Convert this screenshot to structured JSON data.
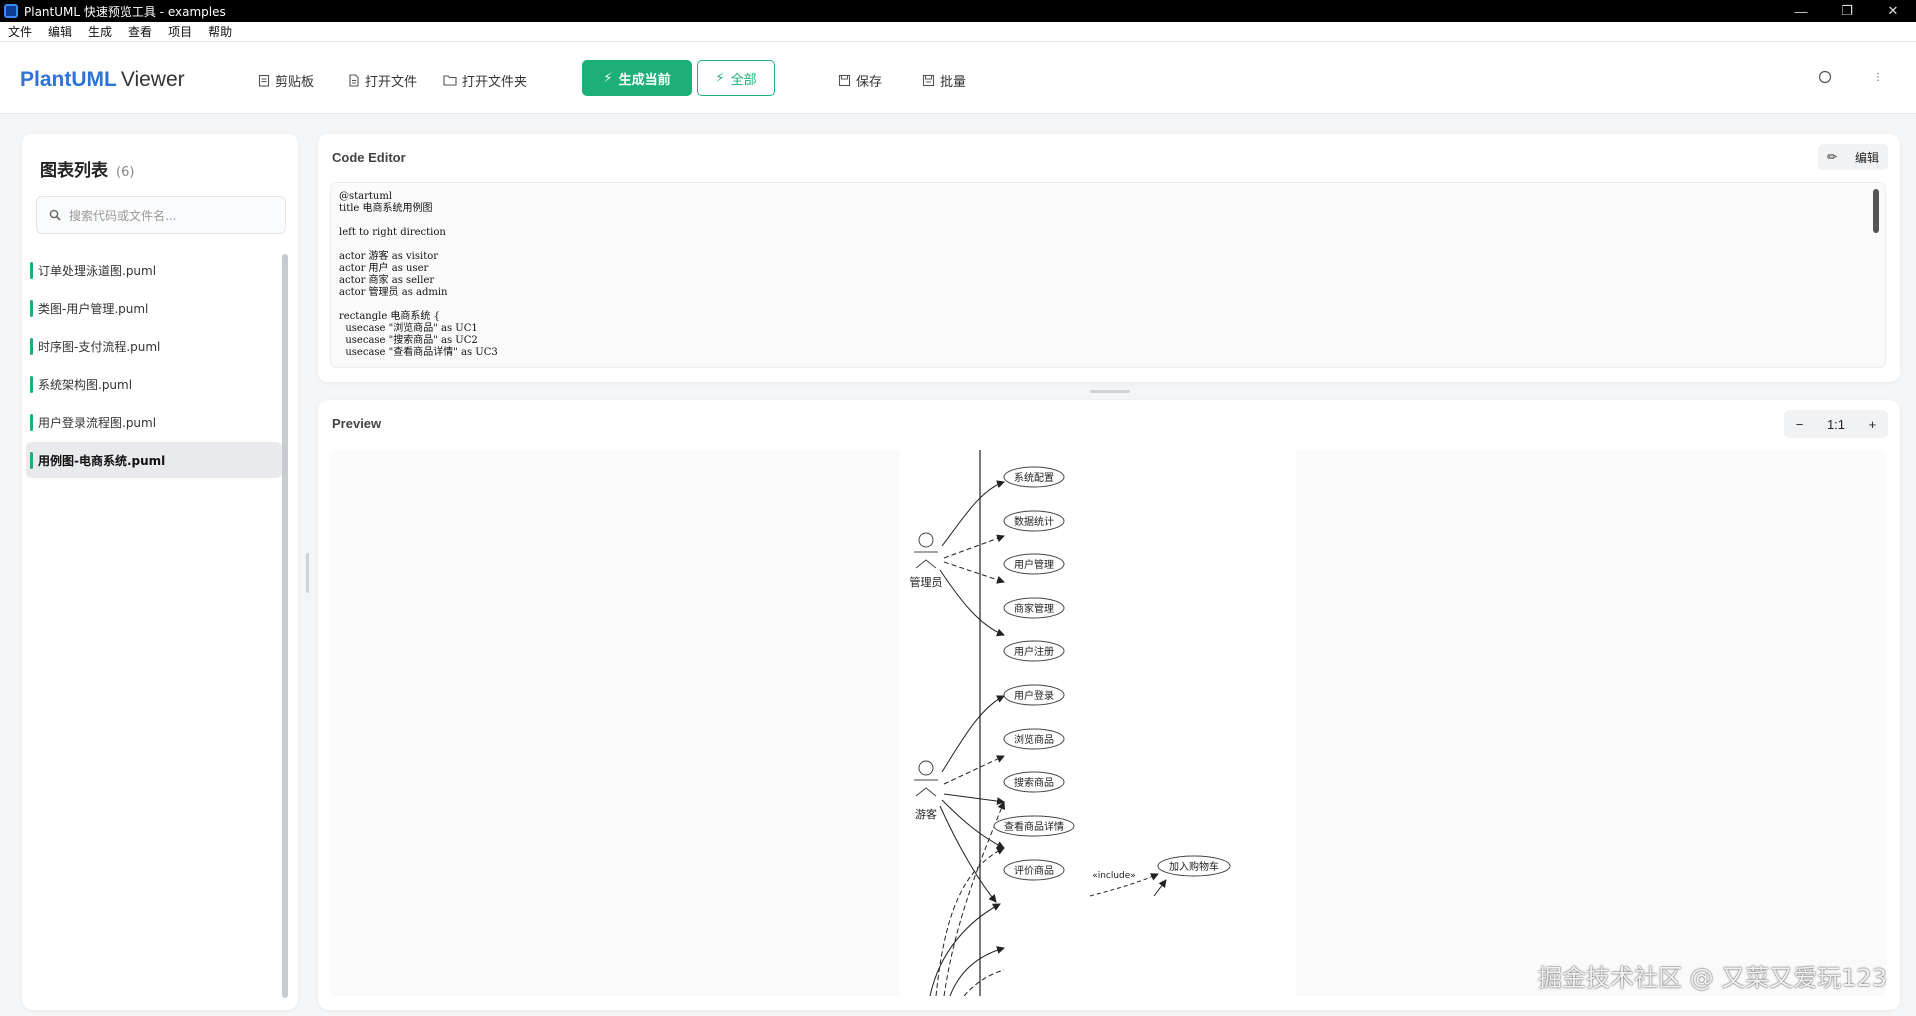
{
  "window": {
    "title": "PlantUML 快速预览工具 - examples",
    "controls": [
      "—",
      "❐",
      "✕"
    ]
  },
  "menu": [
    "文件",
    "编辑",
    "生成",
    "查看",
    "项目",
    "帮助"
  ],
  "toolbar": {
    "brand_main": "PlantUML",
    "brand_suffix": "Viewer",
    "clipboard": "剪贴板",
    "open_file": "打开文件",
    "open_folder": "打开文件夹",
    "generate_current": "生成当前",
    "generate_all": "全部",
    "save": "保存",
    "batch": "批量"
  },
  "sidebar": {
    "title": "图表列表",
    "count": "(6)",
    "search_placeholder": "搜索代码或文件名...",
    "files": [
      {
        "name": "订单处理泳道图.puml",
        "active": false
      },
      {
        "name": "类图-用户管理.puml",
        "active": false
      },
      {
        "name": "时序图-支付流程.puml",
        "active": false
      },
      {
        "name": "系统架构图.puml",
        "active": false
      },
      {
        "name": "用户登录流程图.puml",
        "active": false
      },
      {
        "name": "用例图-电商系统.puml",
        "active": true
      }
    ]
  },
  "editor": {
    "title": "Code Editor",
    "edit_label": "编辑",
    "lines": [
      "@startuml",
      "title 电商系统用例图",
      "",
      "left to right direction",
      "",
      "actor 游客 as visitor",
      "actor 用户 as user",
      "actor 商家 as seller",
      "actor 管理员 as admin",
      "",
      "rectangle 电商系统 {",
      "  usecase \"浏览商品\" as UC1",
      "  usecase \"搜索商品\" as UC2",
      "  usecase \"查看商品详情\" as UC3"
    ]
  },
  "preview": {
    "title": "Preview",
    "zoom_out": "−",
    "zoom_level": "1:1",
    "zoom_in": "+",
    "actors": {
      "admin": "管理员",
      "visitor": "游客"
    },
    "usecases": [
      "系统配置",
      "数据统计",
      "用户管理",
      "商家管理",
      "用户注册",
      "用户登录",
      "浏览商品",
      "搜索商品",
      "查看商品详情",
      "评价商品",
      "加入购物车"
    ],
    "include_label": "«include»"
  },
  "watermark": "掘金技术社区 @ 又菜又爱玩123",
  "colors": {
    "accent": "#1db076",
    "brand": "#2f73d9"
  }
}
